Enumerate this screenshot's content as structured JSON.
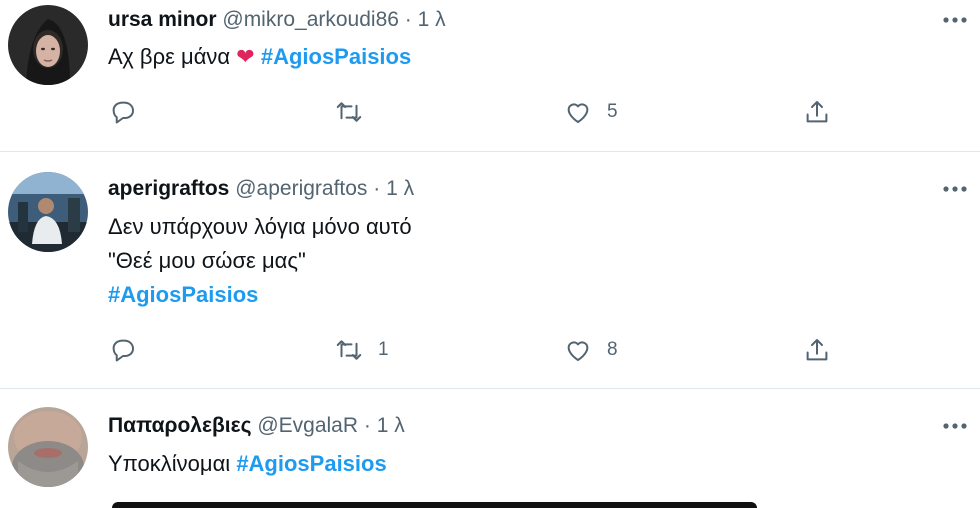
{
  "tweets": [
    {
      "name": "ursa minor",
      "handle": "@mikro_arkoudi86",
      "dot": "·",
      "time": "1 λ",
      "text_plain": "Αχ βρε μάνα",
      "heart": "❤",
      "hashtag": "#AgiosPaisios",
      "reply_count": "",
      "retweet_count": "",
      "like_count": "5"
    },
    {
      "name": "aperigraftos",
      "handle": "@aperigraftos",
      "dot": "·",
      "time": "1 λ",
      "line1": "Δεν υπάρχουν λόγια μόνο αυτό",
      "line2": "\"Θεέ μου σώσε μας\"",
      "hashtag": "#AgiosPaisios",
      "reply_count": "",
      "retweet_count": "1",
      "like_count": "8"
    },
    {
      "name": "Παπαρολεβιες",
      "handle": "@EvgalaR",
      "dot": "·",
      "time": "1 λ",
      "text_plain": "Υποκλίνομαι",
      "hashtag": "#AgiosPaisios"
    }
  ],
  "colors": {
    "hashtag": "#1d9bf0",
    "secondary_text": "#536471",
    "primary_text": "#0f1419",
    "heart": "#e0245e",
    "divider": "#e1e8ed"
  },
  "icons": {
    "reply": "reply-icon",
    "retweet": "retweet-icon",
    "like": "like-icon",
    "share": "share-icon",
    "more": "more-icon"
  }
}
